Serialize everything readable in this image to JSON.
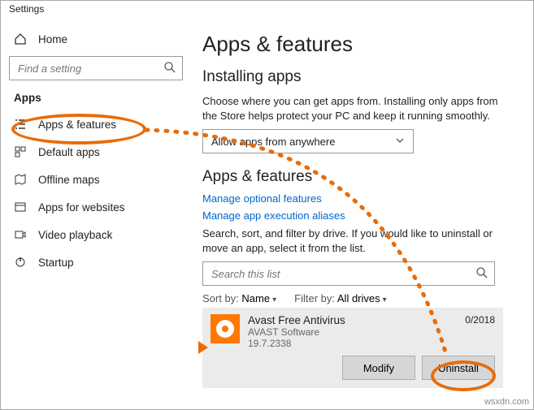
{
  "window": {
    "title": "Settings"
  },
  "sidebar": {
    "home": "Home",
    "search_placeholder": "Find a setting",
    "section": "Apps",
    "items": [
      {
        "label": "Apps & features"
      },
      {
        "label": "Default apps"
      },
      {
        "label": "Offline maps"
      },
      {
        "label": "Apps for websites"
      },
      {
        "label": "Video playback"
      },
      {
        "label": "Startup"
      }
    ]
  },
  "content": {
    "h1": "Apps & features",
    "installing_header": "Installing apps",
    "installing_desc": "Choose where you can get apps from. Installing only apps from the Store helps protect your PC and keep it running smoothly.",
    "source_combo": "Allow apps from anywhere",
    "af_header": "Apps & features",
    "link_optional": "Manage optional features",
    "link_aliases": "Manage app execution aliases",
    "search_desc": "Search, sort, and filter by drive. If you would like to uninstall or move an app, select it from the list.",
    "list_search_placeholder": "Search this list",
    "sort_label": "Sort by:",
    "sort_value": "Name",
    "filter_label": "Filter by:",
    "filter_value": "All drives",
    "app": {
      "name": "Avast Free Antivirus",
      "vendor": "AVAST Software",
      "version": "19.7.2338",
      "date": "0/2018"
    },
    "btn_modify": "Modify",
    "btn_uninstall": "Uninstall"
  },
  "watermark": "wsxdn.com"
}
